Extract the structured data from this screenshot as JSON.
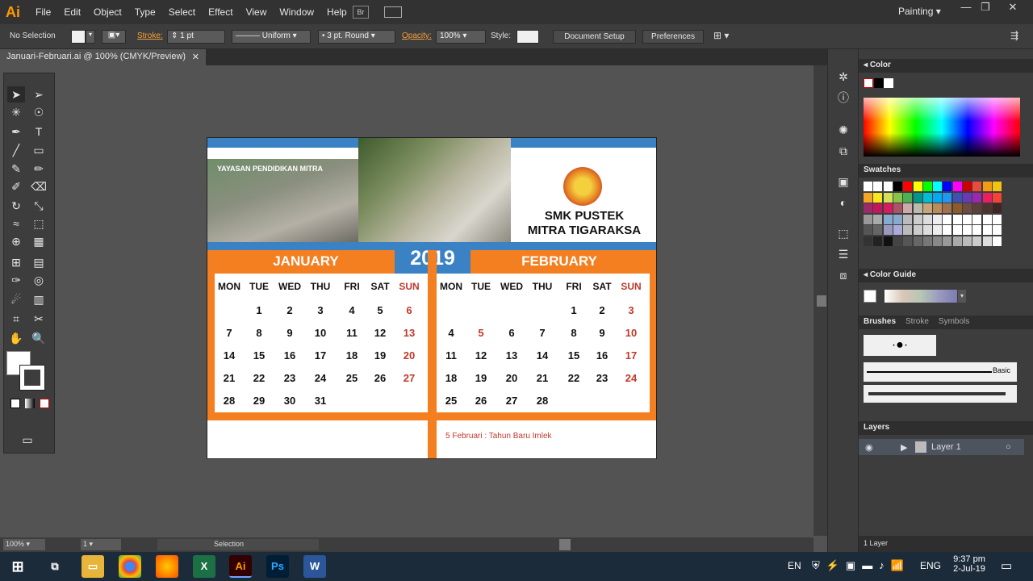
{
  "app": {
    "logo": "Ai",
    "menus": [
      "File",
      "Edit",
      "Object",
      "Type",
      "Select",
      "Effect",
      "View",
      "Window",
      "Help"
    ],
    "workspace": "Painting",
    "bridge_label": "Br"
  },
  "control_bar": {
    "selection": "No Selection",
    "stroke_label": "Stroke:",
    "stroke_value": "1 pt",
    "profile": "Uniform",
    "brush": "3 pt. Round",
    "opacity_label": "Opacity:",
    "opacity_value": "100%",
    "style_label": "Style:",
    "document_setup": "Document Setup",
    "preferences": "Preferences"
  },
  "document_tab": {
    "title": "Januari-Februari.ai @ 100% (CMYK/Preview)"
  },
  "status_bar": {
    "zoom": "100%",
    "artboard": "1",
    "tool": "Selection"
  },
  "panels": {
    "color": {
      "title": "Color"
    },
    "swatches": {
      "title": "Swatches"
    },
    "color_guide": {
      "title": "Color Guide"
    },
    "brushes": {
      "tabs": [
        "Brushes",
        "Stroke",
        "Symbols"
      ],
      "basic": "Basic"
    },
    "layers": {
      "title": "Layers",
      "layer_name": "Layer 1",
      "count": "1 Layer"
    }
  },
  "calendar": {
    "photo_caption": "YAYASAN PENDIDIKAN MITRA",
    "school_line1": "SMK PUSTEK",
    "school_line2": "MITRA TIGARAKSA",
    "year": "2019",
    "weekdays": [
      "MON",
      "TUE",
      "WED",
      "THU",
      "FRI",
      "SAT",
      "SUN"
    ],
    "months": [
      {
        "name": "JANUARY",
        "weeks": [
          [
            "",
            "1",
            "2",
            "3",
            "4",
            "5",
            "6"
          ],
          [
            "7",
            "8",
            "9",
            "10",
            "11",
            "12",
            "13"
          ],
          [
            "14",
            "15",
            "16",
            "17",
            "18",
            "19",
            "20"
          ],
          [
            "21",
            "22",
            "23",
            "24",
            "25",
            "26",
            "27"
          ],
          [
            "28",
            "29",
            "30",
            "31",
            "",
            "",
            ""
          ]
        ],
        "red": []
      },
      {
        "name": "FEBRUARY",
        "weeks": [
          [
            "",
            "",
            "",
            "",
            "1",
            "2",
            "3"
          ],
          [
            "4",
            "5",
            "6",
            "7",
            "8",
            "9",
            "10"
          ],
          [
            "11",
            "12",
            "13",
            "14",
            "15",
            "16",
            "17"
          ],
          [
            "18",
            "19",
            "20",
            "21",
            "22",
            "23",
            "24"
          ],
          [
            "25",
            "26",
            "27",
            "28",
            "",
            "",
            ""
          ]
        ],
        "red": [
          "5"
        ]
      }
    ],
    "note": "5 Februari : Tahun Baru Imlek"
  },
  "taskbar": {
    "lang": "EN",
    "input": "ENG",
    "time": "9:37 pm",
    "date": "2-Jul-19"
  },
  "colors": {
    "orange": "#f47f20",
    "blue": "#3a82c4",
    "accent": "#ff9a00"
  }
}
